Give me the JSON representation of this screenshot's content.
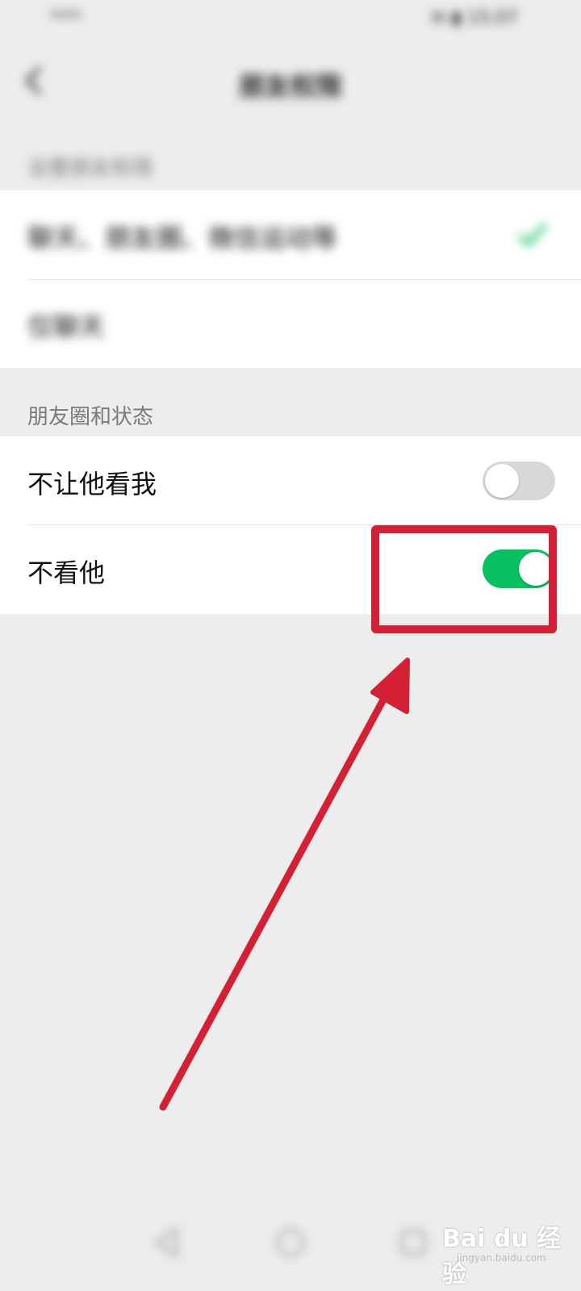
{
  "status_bar": {
    "left": "⁴ᴳ⁴ᴳ",
    "right": "✉ ▮ 15:07"
  },
  "header": {
    "title": "朋友权限"
  },
  "section1": {
    "header": "设置朋友权限",
    "items": [
      {
        "label": "聊天、朋友圈、微信运动等",
        "checked": true
      },
      {
        "label": "仅聊天",
        "checked": false
      }
    ]
  },
  "section2": {
    "header": "朋友圈和状态",
    "items": [
      {
        "label": "不让他看我",
        "toggle_on": false
      },
      {
        "label": "不看他",
        "toggle_on": true
      }
    ]
  },
  "colors": {
    "accent": "#07c160",
    "annotation": "#d42035",
    "background": "#ededed"
  },
  "icons": {
    "back": "chevron-left-icon",
    "check": "check-icon",
    "nav_back": "triangle-back-icon",
    "nav_home": "circle-home-icon",
    "nav_recent": "square-recent-icon"
  },
  "watermark": {
    "text": "Bai du 经验",
    "sub": "jingyan.baidu.com"
  }
}
